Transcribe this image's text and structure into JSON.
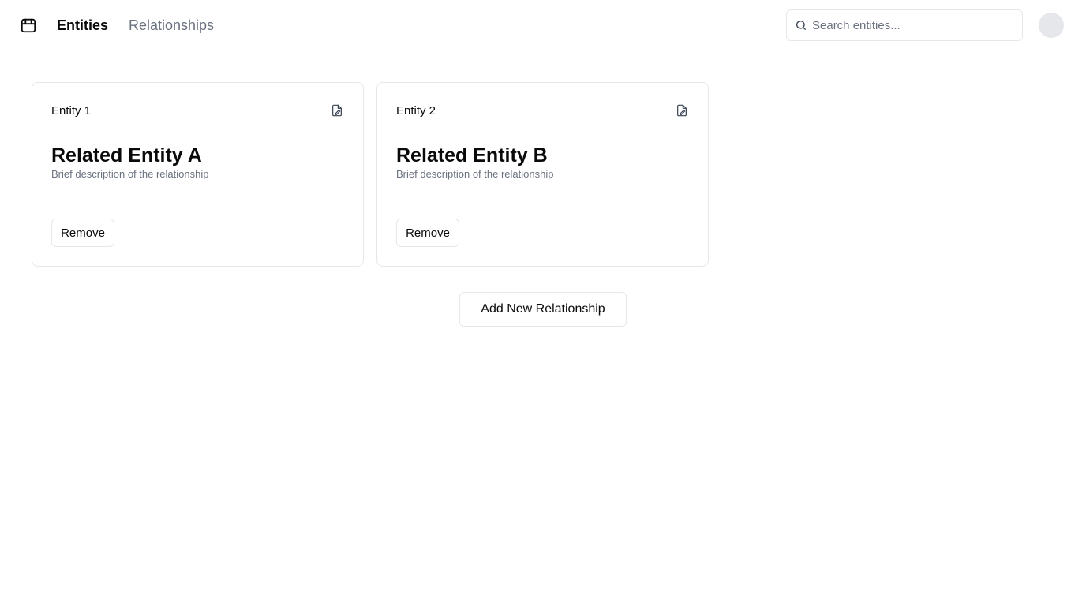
{
  "header": {
    "logo_icon": "package-icon",
    "nav": [
      {
        "label": "Entities",
        "active": true
      },
      {
        "label": "Relationships",
        "active": false
      }
    ],
    "search": {
      "placeholder": "Search entities...",
      "value": "",
      "icon": "search-icon"
    },
    "avatar_icon": "avatar"
  },
  "cards": [
    {
      "label": "Entity 1",
      "edit_icon": "file-edit-icon",
      "title": "Related Entity A",
      "description": "Brief description of the relationship",
      "remove_label": "Remove"
    },
    {
      "label": "Entity 2",
      "edit_icon": "file-edit-icon",
      "title": "Related Entity B",
      "description": "Brief description of the relationship",
      "remove_label": "Remove"
    }
  ],
  "actions": {
    "add_label": "Add New Relationship"
  },
  "colors": {
    "text": "#0a0a0a",
    "muted": "#6b7280",
    "border": "#e5e7eb",
    "background": "#ffffff"
  }
}
